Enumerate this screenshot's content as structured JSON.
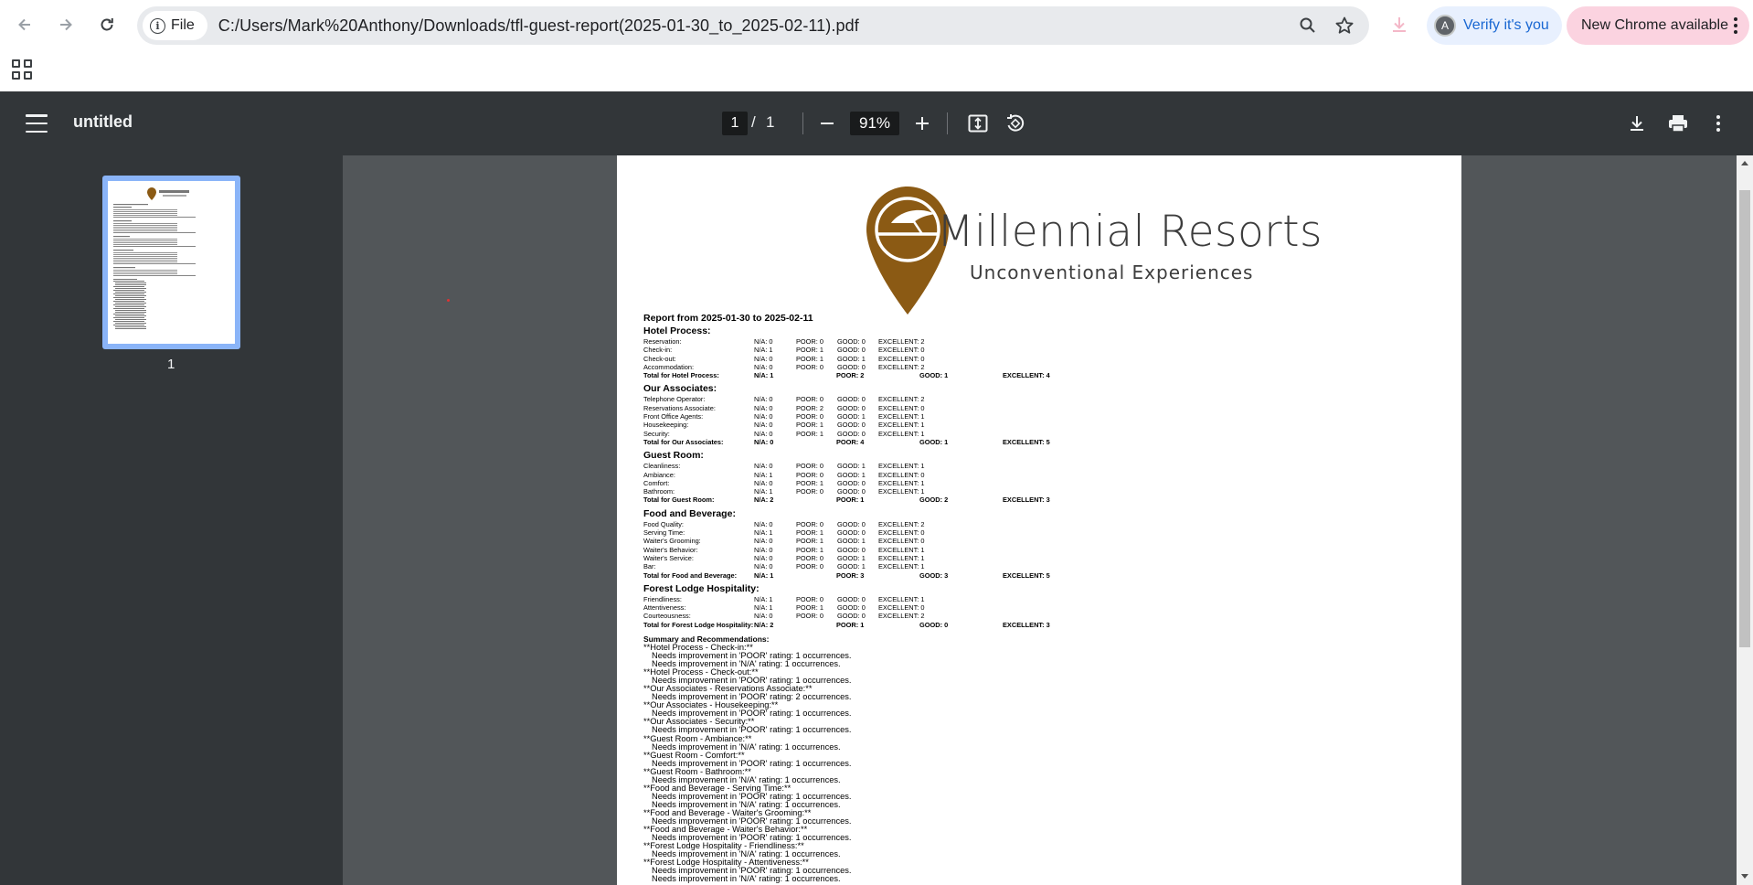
{
  "browser": {
    "url": "C:/Users/Mark%20Anthony/Downloads/tfl-guest-report(2025-01-30_to_2025-02-11).pdf",
    "file_chip": "File",
    "verify_label": "Verify it's you",
    "avatar_letter": "A",
    "update_label": "New Chrome available"
  },
  "viewer": {
    "title": "untitled",
    "page_current": "1",
    "page_sep": "/",
    "page_total": "1",
    "zoom": "91%",
    "thumb_label": "1"
  },
  "pdf": {
    "logo_name": "Millennial Resorts",
    "logo_tagline": "Unconventional Experiences",
    "report_heading": "Report from 2025-01-30 to 2025-02-11",
    "sections": [
      {
        "title": "Hotel Process:",
        "rows": [
          [
            "Reservation:",
            "N/A: 0",
            "POOR: 0",
            "GOOD: 0",
            "EXCELLENT: 2"
          ],
          [
            "Check-in:",
            "N/A: 1",
            "POOR: 1",
            "GOOD: 0",
            "EXCELLENT: 0"
          ],
          [
            "Check-out:",
            "N/A: 0",
            "POOR: 1",
            "GOOD: 1",
            "EXCELLENT: 0"
          ],
          [
            "Accommodation:",
            "N/A: 0",
            "POOR: 0",
            "GOOD: 0",
            "EXCELLENT: 2"
          ]
        ],
        "total": [
          "Total for Hotel Process:",
          "N/A: 1",
          "POOR: 2",
          "GOOD: 1",
          "EXCELLENT: 4"
        ]
      },
      {
        "title": "Our Associates:",
        "rows": [
          [
            "Telephone Operator:",
            "N/A: 0",
            "POOR: 0",
            "GOOD: 0",
            "EXCELLENT: 2"
          ],
          [
            "Reservations Associate:",
            "N/A: 0",
            "POOR: 2",
            "GOOD: 0",
            "EXCELLENT: 0"
          ],
          [
            "Front Office Agents:",
            "N/A: 0",
            "POOR: 0",
            "GOOD: 1",
            "EXCELLENT: 1"
          ],
          [
            "Housekeeping:",
            "N/A: 0",
            "POOR: 1",
            "GOOD: 0",
            "EXCELLENT: 1"
          ],
          [
            "Security:",
            "N/A: 0",
            "POOR: 1",
            "GOOD: 0",
            "EXCELLENT: 1"
          ]
        ],
        "total": [
          "Total for Our Associates:",
          "N/A: 0",
          "POOR: 4",
          "GOOD: 1",
          "EXCELLENT: 5"
        ]
      },
      {
        "title": "Guest Room:",
        "rows": [
          [
            "Cleanliness:",
            "N/A: 0",
            "POOR: 0",
            "GOOD: 1",
            "EXCELLENT: 1"
          ],
          [
            "Ambiance:",
            "N/A: 1",
            "POOR: 0",
            "GOOD: 1",
            "EXCELLENT: 0"
          ],
          [
            "Comfort:",
            "N/A: 0",
            "POOR: 1",
            "GOOD: 0",
            "EXCELLENT: 1"
          ],
          [
            "Bathroom:",
            "N/A: 1",
            "POOR: 0",
            "GOOD: 0",
            "EXCELLENT: 1"
          ]
        ],
        "total": [
          "Total for Guest Room:",
          "N/A: 2",
          "POOR: 1",
          "GOOD: 2",
          "EXCELLENT: 3"
        ]
      },
      {
        "title": "Food and Beverage:",
        "rows": [
          [
            "Food Quality:",
            "N/A: 0",
            "POOR: 0",
            "GOOD: 0",
            "EXCELLENT: 2"
          ],
          [
            "Serving Time:",
            "N/A: 1",
            "POOR: 1",
            "GOOD: 0",
            "EXCELLENT: 0"
          ],
          [
            "Waiter's Grooming:",
            "N/A: 0",
            "POOR: 1",
            "GOOD: 1",
            "EXCELLENT: 0"
          ],
          [
            "Waiter's Behavior:",
            "N/A: 0",
            "POOR: 1",
            "GOOD: 0",
            "EXCELLENT: 1"
          ],
          [
            "Waiter's Service:",
            "N/A: 0",
            "POOR: 0",
            "GOOD: 1",
            "EXCELLENT: 1"
          ],
          [
            "Bar:",
            "N/A: 0",
            "POOR: 0",
            "GOOD: 1",
            "EXCELLENT: 1"
          ]
        ],
        "total": [
          "Total for Food and Beverage:",
          "N/A: 1",
          "POOR: 3",
          "GOOD: 3",
          "EXCELLENT: 5"
        ]
      },
      {
        "title": "Forest Lodge Hospitality:",
        "rows": [
          [
            "Friendliness:",
            "N/A: 1",
            "POOR: 0",
            "GOOD: 0",
            "EXCELLENT: 1"
          ],
          [
            "Attentiveness:",
            "N/A: 1",
            "POOR: 1",
            "GOOD: 0",
            "EXCELLENT: 0"
          ],
          [
            "Courteousness:",
            "N/A: 0",
            "POOR: 0",
            "GOOD: 0",
            "EXCELLENT: 2"
          ]
        ],
        "total": [
          "Total for Forest Lodge Hospitality:",
          "N/A: 2",
          "POOR: 1",
          "GOOD: 0",
          "EXCELLENT: 3"
        ]
      }
    ],
    "summary_title": "Summary and Recommendations:",
    "summary": [
      {
        "head": "**Hotel Process - Check-in:**",
        "lines": [
          "Needs improvement in 'POOR' rating: 1 occurrences.",
          "Needs improvement in 'N/A' rating: 1 occurrences."
        ]
      },
      {
        "head": "**Hotel Process - Check-out:**",
        "lines": [
          "Needs improvement in 'POOR' rating: 1 occurrences."
        ]
      },
      {
        "head": "**Our Associates - Reservations Associate:**",
        "lines": [
          "Needs improvement in 'POOR' rating: 2 occurrences."
        ]
      },
      {
        "head": "**Our Associates - Housekeeping:**",
        "lines": [
          "Needs improvement in 'POOR' rating: 1 occurrences."
        ]
      },
      {
        "head": "**Our Associates - Security:**",
        "lines": [
          "Needs improvement in 'POOR' rating: 1 occurrences."
        ]
      },
      {
        "head": "**Guest Room - Ambiance:**",
        "lines": [
          "Needs improvement in 'N/A' rating: 1 occurrences."
        ]
      },
      {
        "head": "**Guest Room - Comfort:**",
        "lines": [
          "Needs improvement in 'POOR' rating: 1 occurrences."
        ]
      },
      {
        "head": "**Guest Room - Bathroom:**",
        "lines": [
          "Needs improvement in 'N/A' rating: 1 occurrences."
        ]
      },
      {
        "head": "**Food and Beverage - Serving Time:**",
        "lines": [
          "Needs improvement in 'POOR' rating: 1 occurrences.",
          "Needs improvement in 'N/A' rating: 1 occurrences."
        ]
      },
      {
        "head": "**Food and Beverage - Waiter's Grooming:**",
        "lines": [
          "Needs improvement in 'POOR' rating: 1 occurrences."
        ]
      },
      {
        "head": "**Food and Beverage - Waiter's Behavior:**",
        "lines": [
          "Needs improvement in 'POOR' rating: 1 occurrences."
        ]
      },
      {
        "head": "**Forest Lodge Hospitality - Friendliness:**",
        "lines": [
          "Needs improvement in 'N/A' rating: 1 occurrences."
        ]
      },
      {
        "head": "**Forest Lodge Hospitality - Attentiveness:**",
        "lines": [
          "Needs improvement in 'POOR' rating: 1 occurrences.",
          "Needs improvement in 'N/A' rating: 1 occurrences."
        ]
      }
    ]
  },
  "colors": {
    "toolbar_bg": "#323639",
    "viewer_bg": "#525659",
    "logo_brown": "#8b5a14",
    "thumb_border": "#8ab4f8",
    "verify_bg": "#e8f0fe",
    "update_bg": "#fbd3e0"
  }
}
